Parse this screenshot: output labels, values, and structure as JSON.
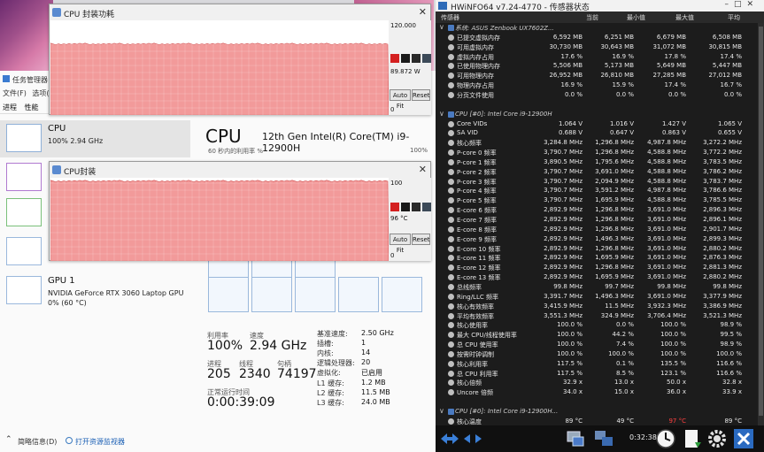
{
  "task_manager": {
    "title": "任务管理器",
    "menu": [
      "文件(F)",
      "选项("
    ],
    "tabs": [
      "进程",
      "性能"
    ],
    "left_items": [
      {
        "name": "CPU",
        "sub": "100% 2.94 GHz"
      },
      {
        "name": "",
        "sub": ""
      },
      {
        "name": "",
        "sub": ""
      },
      {
        "name": "",
        "sub": ""
      },
      {
        "name": "GPU 1",
        "sub": "NVIDIA GeForce RTX 3060 Laptop GPU\n0% (60 °C)"
      }
    ],
    "header": "CPU",
    "model": "12th Gen Intel(R) Core(TM) i9-12900H",
    "util_label": "60 秒内的利用率 %",
    "util_max": "100%",
    "stats": {
      "util_label": "利用率",
      "util_value": "100%",
      "speed_label": "速度",
      "speed_value": "2.94 GHz",
      "proc_label": "进程",
      "proc_value": "205",
      "thread_label": "线程",
      "thread_value": "2340",
      "handle_label": "句柄",
      "handle_value": "74197",
      "uptime_label": "正常运行时间",
      "uptime_value": "0:00:39:09"
    },
    "details": [
      {
        "k": "基准速度:",
        "v": "2.50 GHz"
      },
      {
        "k": "插槽:",
        "v": "1"
      },
      {
        "k": "内核:",
        "v": "14"
      },
      {
        "k": "逻辑处理器:",
        "v": "20"
      },
      {
        "k": "虚拟化:",
        "v": "已启用"
      },
      {
        "k": "L1 缓存:",
        "v": "1.2 MB"
      },
      {
        "k": "L2 缓存:",
        "v": "11.5 MB"
      },
      {
        "k": "L3 缓存:",
        "v": "24.0 MB"
      }
    ],
    "footer_brief": "简略信息(D)",
    "footer_monitor": "打开资源监视器"
  },
  "power_window": {
    "title": "CPU 封装功耗",
    "max_label": "120.000",
    "current": "89.872 W",
    "min_label": "0",
    "auto_fit": "Auto Fit",
    "reset": "Reset",
    "colors": [
      "#d42020",
      "#1a1a1a",
      "#2a2a2a",
      "#3c4a58"
    ],
    "trace_level": 0.75
  },
  "temp_window": {
    "title": "CPU封装",
    "max_label": "100",
    "current": "96 °C",
    "min_label": "0",
    "auto_fit": "Auto Fit",
    "reset": "Reset",
    "colors": [
      "#d42020",
      "#1a1a1a",
      "#2a2a2a",
      "#3c4a58"
    ],
    "trace_level": 0.96
  },
  "hwinfo": {
    "title": "HWiNFO64 v7.24-4770 - 传感器状态",
    "columns": [
      "传感器",
      "当前",
      "最小值",
      "最大值",
      "平均"
    ],
    "rows": [
      {
        "t": "sec",
        "name": "系统: ASUS Zenbook UX7602Z...",
        "v": [
          "",
          "",
          "",
          ""
        ]
      },
      {
        "name": "已提交虚拟内存",
        "v": [
          "6,592 MB",
          "6,251 MB",
          "6,679 MB",
          "6,508 MB"
        ]
      },
      {
        "name": "可用虚拟内存",
        "v": [
          "30,730 MB",
          "30,643 MB",
          "31,072 MB",
          "30,815 MB"
        ]
      },
      {
        "name": "虚拟内存占用",
        "v": [
          "17.6 %",
          "16.9 %",
          "17.8 %",
          "17.4 %"
        ]
      },
      {
        "name": "已使用物理内存",
        "v": [
          "5,506 MB",
          "5,173 MB",
          "5,649 MB",
          "5,447 MB"
        ]
      },
      {
        "name": "可用物理内存",
        "v": [
          "26,952 MB",
          "26,810 MB",
          "27,285 MB",
          "27,012 MB"
        ]
      },
      {
        "name": "物理内存占用",
        "v": [
          "16.9 %",
          "15.9 %",
          "17.4 %",
          "16.7 %"
        ]
      },
      {
        "name": "分页文件使用",
        "v": [
          "0.0 %",
          "0.0 %",
          "0.0 %",
          "0.0 %"
        ]
      },
      {
        "t": "blank",
        "name": "",
        "v": [
          "",
          "",
          "",
          ""
        ]
      },
      {
        "t": "sec",
        "name": "CPU [#0]: Intel Core i9-12900H",
        "v": [
          "",
          "",
          "",
          ""
        ]
      },
      {
        "name": "Core VIDs",
        "v": [
          "1.064 V",
          "1.016 V",
          "1.427 V",
          "1.065 V"
        ]
      },
      {
        "name": "SA VID",
        "v": [
          "0.688 V",
          "0.647 V",
          "0.863 V",
          "0.655 V"
        ]
      },
      {
        "name": "核心频率",
        "v": [
          "3,284.8 MHz",
          "1,296.8 MHz",
          "4,987.8 MHz",
          "3,272.2 MHz"
        ]
      },
      {
        "name": "P-core 0 频率",
        "v": [
          "3,790.7 MHz",
          "1,296.8 MHz",
          "4,588.8 MHz",
          "3,772.2 MHz"
        ]
      },
      {
        "name": "P-core 1 频率",
        "v": [
          "3,890.5 MHz",
          "1,795.6 MHz",
          "4,588.8 MHz",
          "3,783.5 MHz"
        ]
      },
      {
        "name": "P-core 2 频率",
        "v": [
          "3,790.7 MHz",
          "3,691.0 MHz",
          "4,588.8 MHz",
          "3,786.2 MHz"
        ]
      },
      {
        "name": "P-core 3 频率",
        "v": [
          "3,790.7 MHz",
          "2,094.9 MHz",
          "4,588.8 MHz",
          "3,783.7 MHz"
        ]
      },
      {
        "name": "P-core 4 频率",
        "v": [
          "3,790.7 MHz",
          "3,591.2 MHz",
          "4,987.8 MHz",
          "3,786.6 MHz"
        ]
      },
      {
        "name": "P-core 5 频率",
        "v": [
          "3,790.7 MHz",
          "1,695.9 MHz",
          "4,588.8 MHz",
          "3,785.5 MHz"
        ]
      },
      {
        "name": "E-core 6 频率",
        "v": [
          "2,892.9 MHz",
          "1,296.8 MHz",
          "3,691.0 MHz",
          "2,896.3 MHz"
        ]
      },
      {
        "name": "E-core 7 频率",
        "v": [
          "2,892.9 MHz",
          "1,296.8 MHz",
          "3,691.0 MHz",
          "2,896.1 MHz"
        ]
      },
      {
        "name": "E-core 8 频率",
        "v": [
          "2,892.9 MHz",
          "1,296.8 MHz",
          "3,691.0 MHz",
          "2,901.7 MHz"
        ]
      },
      {
        "name": "E-core 9 频率",
        "v": [
          "2,892.9 MHz",
          "1,496.3 MHz",
          "3,691.0 MHz",
          "2,899.3 MHz"
        ]
      },
      {
        "name": "E-core 10 频率",
        "v": [
          "2,892.9 MHz",
          "1,296.8 MHz",
          "3,691.0 MHz",
          "2,880.2 MHz"
        ]
      },
      {
        "name": "E-core 11 频率",
        "v": [
          "2,892.9 MHz",
          "1,695.9 MHz",
          "3,691.0 MHz",
          "2,876.3 MHz"
        ]
      },
      {
        "name": "E-core 12 频率",
        "v": [
          "2,892.9 MHz",
          "1,296.8 MHz",
          "3,691.0 MHz",
          "2,881.3 MHz"
        ]
      },
      {
        "name": "E-core 13 频率",
        "v": [
          "2,892.9 MHz",
          "1,695.9 MHz",
          "3,691.0 MHz",
          "2,880.2 MHz"
        ]
      },
      {
        "name": "总线频率",
        "v": [
          "99.8 MHz",
          "99.7 MHz",
          "99.8 MHz",
          "99.8 MHz"
        ]
      },
      {
        "name": "Ring/LLC 频率",
        "v": [
          "3,391.7 MHz",
          "1,496.3 MHz",
          "3,691.0 MHz",
          "3,377.9 MHz"
        ]
      },
      {
        "name": "核心有效频率",
        "v": [
          "3,415.9 MHz",
          "11.5 MHz",
          "3,932.3 MHz",
          "3,386.9 MHz"
        ]
      },
      {
        "name": "平均有效频率",
        "v": [
          "3,551.3 MHz",
          "324.9 MHz",
          "3,706.4 MHz",
          "3,521.3 MHz"
        ]
      },
      {
        "name": "核心使用率",
        "v": [
          "100.0 %",
          "0.0 %",
          "100.0 %",
          "98.9 %"
        ]
      },
      {
        "name": "最大 CPU/线程使用率",
        "v": [
          "100.0 %",
          "44.2 %",
          "100.0 %",
          "99.5 %"
        ]
      },
      {
        "name": "总 CPU 使用率",
        "v": [
          "100.0 %",
          "7.4 %",
          "100.0 %",
          "98.9 %"
        ]
      },
      {
        "name": "按需时钟调制",
        "v": [
          "100.0 %",
          "100.0 %",
          "100.0 %",
          "100.0 %"
        ]
      },
      {
        "name": "核心利用率",
        "v": [
          "117.5 %",
          "0.1 %",
          "135.5 %",
          "116.6 %"
        ]
      },
      {
        "name": "总 CPU 利用率",
        "v": [
          "117.5 %",
          "8.5 %",
          "123.1 %",
          "116.6 %"
        ]
      },
      {
        "name": "核心倍频",
        "v": [
          "32.9 x",
          "13.0 x",
          "50.0 x",
          "32.8 x"
        ]
      },
      {
        "name": "Uncore 倍频",
        "v": [
          "34.0 x",
          "15.0 x",
          "36.0 x",
          "33.9 x"
        ]
      },
      {
        "t": "blank",
        "name": "",
        "v": [
          "",
          "",
          "",
          ""
        ]
      },
      {
        "t": "sec",
        "name": "CPU [#0]: Intel Core i9-12900H...",
        "v": [
          "",
          "",
          "",
          ""
        ]
      },
      {
        "name": "核心温度",
        "v": [
          "89 °C",
          "49 °C",
          "97 °C",
          "89 °C"
        ]
      }
    ],
    "clock": "0:32:38"
  }
}
